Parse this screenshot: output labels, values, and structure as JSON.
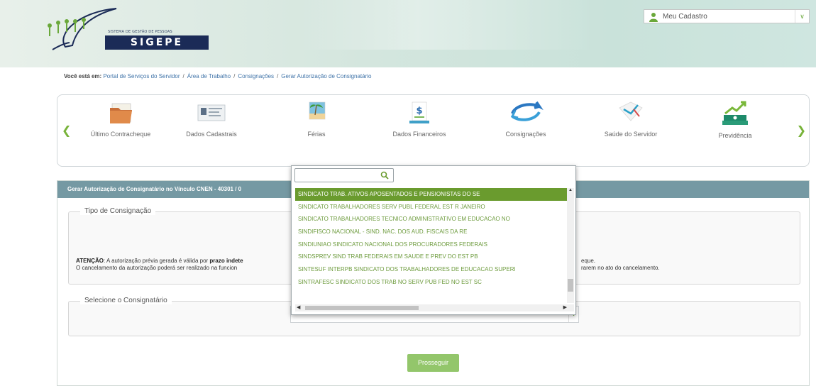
{
  "header": {
    "logo_subtitle": "SISTEMA DE GESTÃO DE PESSOAS",
    "logo_name": "SIGEPE",
    "user_menu": {
      "label": "Meu Cadastro",
      "icon": "user-icon"
    }
  },
  "breadcrumb": {
    "prefix": "Você está em:",
    "separator": "/",
    "items": [
      "Portal de Serviços do Servidor",
      "Área de Trabalho",
      "Consignações",
      "Gerar Autorização de Consignatário"
    ]
  },
  "services": {
    "items": [
      {
        "label": "Último Contracheque",
        "icon": "folder-icon"
      },
      {
        "label": "Dados Cadastrais",
        "icon": "id-card-icon"
      },
      {
        "label": "Férias",
        "icon": "beach-icon"
      },
      {
        "label": "Dados Financeiros",
        "icon": "money-icon"
      },
      {
        "label": "Consignações",
        "icon": "exchange-icon"
      },
      {
        "label": "Saúde do Servidor",
        "icon": "health-icon"
      },
      {
        "label": "Previdência",
        "icon": "pension-icon"
      }
    ]
  },
  "panel": {
    "title": "Gerar Autorização de Consignatário no Vínculo CNEN - 40301 / 0",
    "tipo_legend": "Tipo de Consignação",
    "attention_label": "ATENÇÃO",
    "attention_line1_a": ": A autorização prévia gerada é válida por ",
    "attention_line1_b": "prazo indete",
    "attention_line2": "O cancelamento da autorização poderá ser realizado na funcion",
    "attention_right1": "eque.",
    "attention_right2": "rarem no ato do cancelamento.",
    "consignatario_legend": "Selecione o Consignatário",
    "proceed_button": "Prosseguir"
  },
  "dropdown": {
    "search_value": "",
    "selected_index": 0,
    "options": [
      "SINDICATO TRAB. ATIVOS APOSENTADOS E PENSIONISTAS DO SE",
      "SINDICATO TRABALHADORES SERV PUBL FEDERAL EST R JANEIRO",
      "SINDICATO TRABALHADORES TECNICO ADMINISTRATIVO EM EDUCACAO NO",
      "SINDIFISCO NACIONAL - SIND. NAC. DOS AUD. FISCAIS DA RE",
      "SINDIUNIAO SINDICATO NACIONAL DOS PROCURADORES FEDERAIS",
      "SINDSPREV SIND TRAB FEDERAIS EM SAUDE E PREV DO EST PB",
      "SINTESUF INTERPB SINDICATO DOS TRABALHADORES DE EDUCACAO SUPERI",
      "SINTRAFESC SINDICATO DOS TRAB NO SERV PUB FED NO EST SC"
    ]
  },
  "colors": {
    "accent_green": "#6a9b2e",
    "panel_header": "#7599a3",
    "link_blue": "#3f73a8",
    "button_green": "#93c66b"
  }
}
